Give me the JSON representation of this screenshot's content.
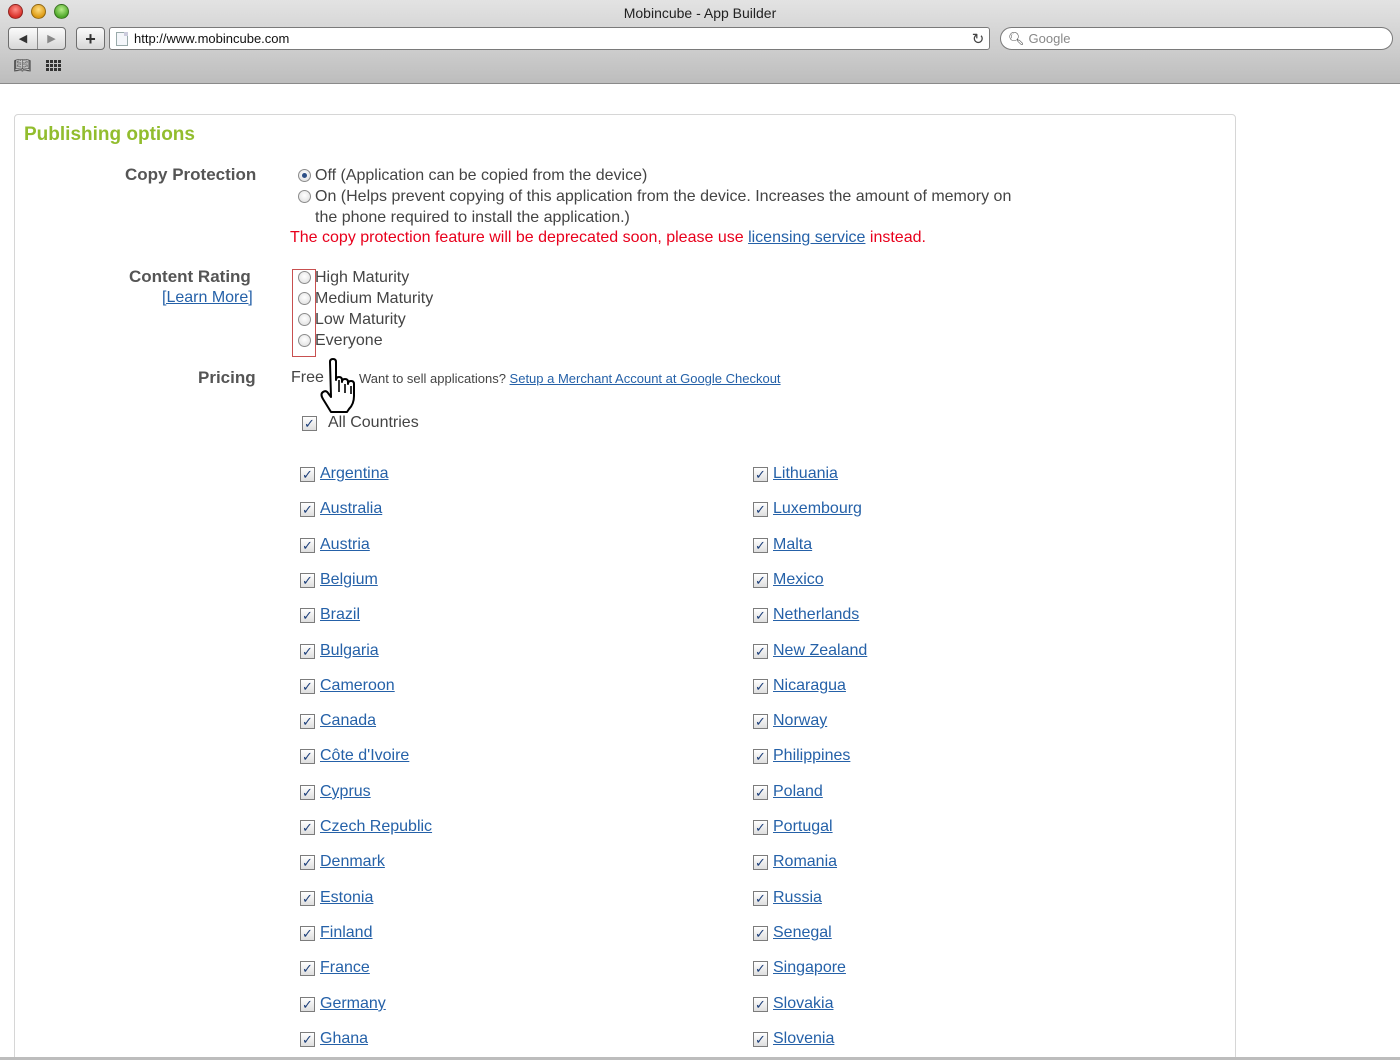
{
  "window": {
    "title": "Mobincube - App Builder",
    "url": "http://www.mobincube.com",
    "search_placeholder": "Google",
    "back_icon": "back-arrow-icon",
    "forward_icon": "forward-arrow-icon",
    "add_icon": "plus-icon",
    "reload_icon": "reload-icon"
  },
  "section": {
    "title": "Publishing options",
    "title_color": "#92bd2e"
  },
  "copy_protection": {
    "label": "Copy Protection",
    "options": [
      {
        "text": "Off (Application can be copied from the device)",
        "selected": true
      },
      {
        "text": "On (Helps prevent copying of this application from the device. Increases the amount of memory on",
        "text2": "the phone required to install the application.)",
        "selected": false
      }
    ],
    "warning_before": "The copy protection feature will be deprecated soon, please use ",
    "warning_link": "licensing service",
    "warning_after": " instead.",
    "warning_color": "#e8001c"
  },
  "content_rating": {
    "label": "Content Rating",
    "learn_more": "[Learn More]",
    "options": [
      "High Maturity",
      "Medium Maturity",
      "Low Maturity",
      "Everyone"
    ]
  },
  "pricing": {
    "label": "Pricing",
    "value": "Free",
    "hint": "Want to sell applications? ",
    "hint_link": "Setup a Merchant Account at Google Checkout"
  },
  "countries": {
    "all_label": "All Countries",
    "all_checked": true,
    "left": [
      "Argentina",
      "Australia",
      "Austria",
      "Belgium",
      "Brazil",
      "Bulgaria",
      "Cameroon",
      "Canada",
      "Côte d'Ivoire",
      "Cyprus",
      "Czech Republic",
      "Denmark",
      "Estonia",
      "Finland",
      "France",
      "Germany",
      "Ghana"
    ],
    "right": [
      "Lithuania",
      "Luxembourg",
      "Malta",
      "Mexico",
      "Netherlands",
      "New Zealand",
      "Nicaragua",
      "Norway",
      "Philippines",
      "Poland",
      "Portugal",
      "Romania",
      "Russia",
      "Senegal",
      "Singapore",
      "Slovakia",
      "Slovenia"
    ],
    "check_glyph": "✓",
    "link_color": "#2561a8"
  }
}
